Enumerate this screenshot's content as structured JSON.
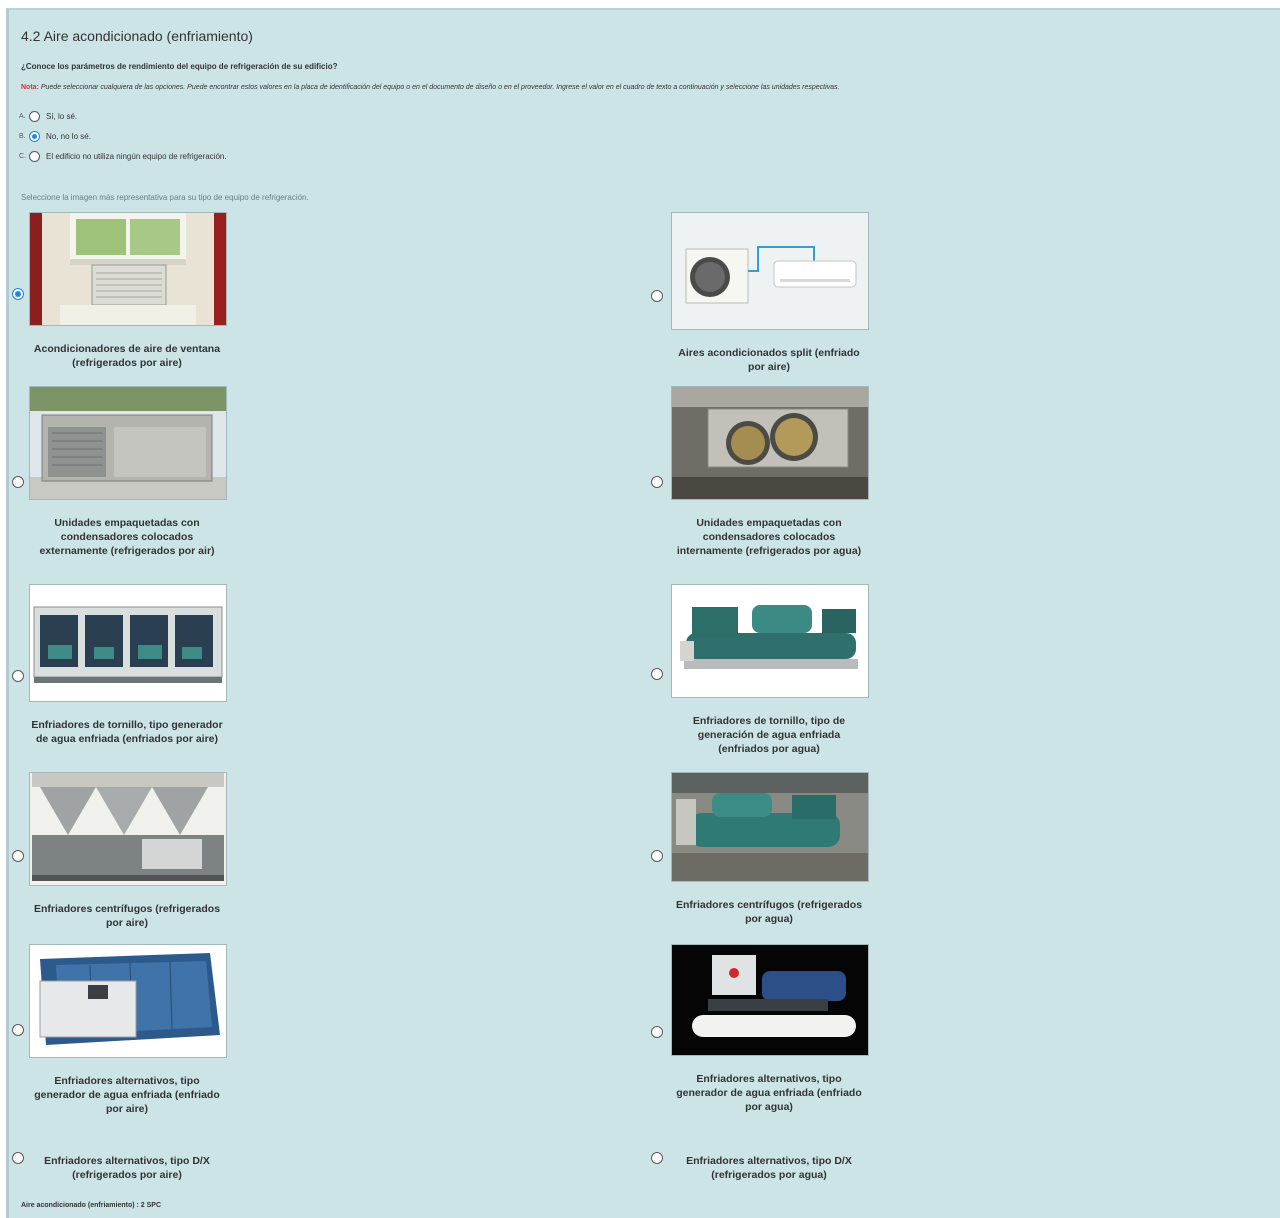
{
  "section": {
    "title": "4.2 Aire acondicionado (enfriamiento)"
  },
  "question": {
    "text": "¿Conoce los parámetros de rendimiento del equipo de refrigeración de su edificio?",
    "note_label": "Nota:",
    "note_text": "Puede seleccionar cualquiera de las opciones. Puede encontrar estos valores en la placa de identificación del equipo o en el documento de diseño o en el proveedor. Ingrese el valor en el cuadro de texto a continuación y seleccione las unidades respectivas."
  },
  "options": [
    {
      "letter": "A.",
      "label": "Sí, lo sé.",
      "selected": false
    },
    {
      "letter": "B.",
      "label": "No, no lo sé.",
      "selected": true
    },
    {
      "letter": "C.",
      "label": "El edificio no utiliza ningún equipo de refrigeración.",
      "selected": false
    }
  ],
  "equipment_instruction": "Seleccione la imagen más representativa para su tipo de equipo de refrigeración.",
  "equipment": [
    {
      "caption": "Acondicionadores de aire de ventana (refrigerados por aire)",
      "selected": true,
      "icon": "window-ac-photo"
    },
    {
      "caption": "Aires acondicionados split (enfriado por aire)",
      "selected": false,
      "icon": "split-ac-photo"
    },
    {
      "caption": "Unidades empaquetadas con condensadores colocados externamente (refrigerados por air)",
      "selected": false,
      "icon": "rooftop-unit-photo"
    },
    {
      "caption": "Unidades empaquetadas con condensadores colocados internamente (refrigerados por agua)",
      "selected": false,
      "icon": "indoor-unit-photo"
    },
    {
      "caption": "Enfriadores de tornillo, tipo generador de agua enfriada (enfriados por aire)",
      "selected": false,
      "icon": "air-screw-chiller-photo"
    },
    {
      "caption": "Enfriadores de tornillo, tipo de generación de agua enfriada (enfriados por agua)",
      "selected": false,
      "icon": "water-screw-chiller-photo"
    },
    {
      "caption": "Enfriadores centrífugos (refrigerados por aire)",
      "selected": false,
      "icon": "air-centrifugal-chiller-photo"
    },
    {
      "caption": "Enfriadores centrífugos (refrigerados por agua)",
      "selected": false,
      "icon": "water-centrifugal-chiller-photo"
    },
    {
      "caption": "Enfriadores alternativos, tipo generador de agua enfriada (enfriado por aire)",
      "selected": false,
      "icon": "air-reciprocating-chiller-photo"
    },
    {
      "caption": "Enfriadores alternativos, tipo generador de agua enfriada (enfriado por agua)",
      "selected": false,
      "icon": "water-reciprocating-chiller-photo"
    },
    {
      "caption": "Enfriadores alternativos, tipo D/X (refrigerados por aire)",
      "selected": false,
      "icon": ""
    },
    {
      "caption": "Enfriadores alternativos, tipo D/X (refrigerados por agua)",
      "selected": false,
      "icon": ""
    }
  ],
  "footer": "Aire acondicionado (enfriamiento) : 2 SPC",
  "colors": {
    "panel_bg": "#cce4e6",
    "accent": "#1e88e5",
    "note_red": "#d9302a"
  }
}
